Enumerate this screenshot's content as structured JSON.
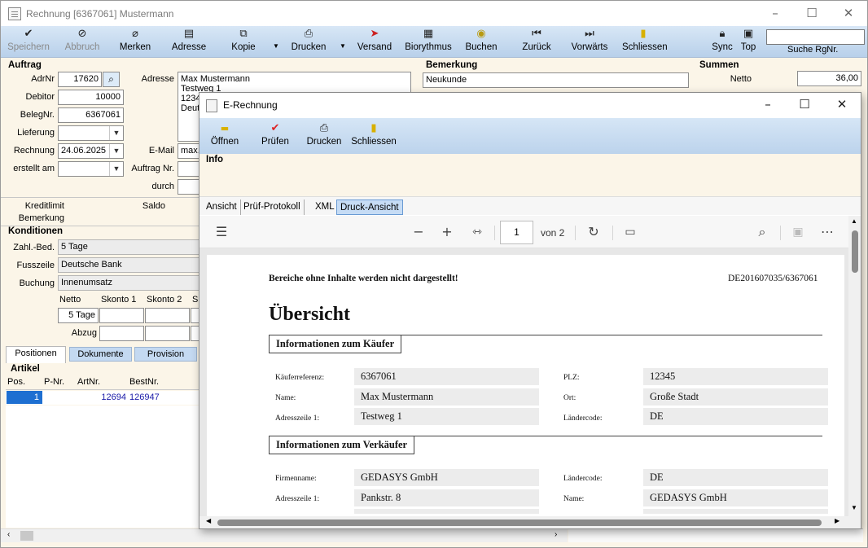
{
  "main_window": {
    "title": "Rechnung [6367061] Mustermann",
    "toolbar": {
      "speichern": "Speichern",
      "abbruch": "Abbruch",
      "merken": "Merken",
      "adresse": "Adresse",
      "kopie": "Kopie",
      "drucken": "Drucken",
      "versand": "Versand",
      "biorythmus": "Biorythmus",
      "buchen": "Buchen",
      "zurueck": "Zurück",
      "vorwaerts": "Vorwärts",
      "schliessen": "Schliessen",
      "sync": "Sync",
      "top": "Top",
      "search_value": "",
      "search_label": "Suche RgNr."
    },
    "auftrag": {
      "section": "Auftrag",
      "adrnr_label": "AdrNr",
      "adrnr": "17620",
      "debitor_label": "Debitor",
      "debitor": "10000",
      "belegnr_label": "BelegNr.",
      "belegnr": "6367061",
      "lieferung_label": "Lieferung",
      "lieferung": "",
      "rechnung_label": "Rechnung",
      "rechnung": "24.06.2025",
      "erstellt_label": "erstellt am",
      "erstellt": "",
      "adresse_label": "Adresse",
      "adresse_l1": "Max Mustermann",
      "adresse_l2": "Testweg 1",
      "adresse_l3": "1234",
      "adresse_l4": "Deut",
      "email_label": "E-Mail",
      "email": "max.",
      "auftragnr_label": "Auftrag Nr.",
      "durch_label": "durch"
    },
    "bemerkung": {
      "section": "Bemerkung",
      "value": "Neukunde"
    },
    "summen": {
      "section": "Summen",
      "netto_label": "Netto",
      "netto": "36,00"
    },
    "kredit": {
      "kreditlimit": "Kreditlimit",
      "saldo": "Saldo",
      "bemerkung": "Bemerkung"
    },
    "konditionen": {
      "section": "Konditionen",
      "zahl_label": "Zahl.-Bed.",
      "zahl": "5 Tage",
      "fuss_label": "Fusszeile",
      "fuss": "Deutsche Bank",
      "buchung_label": "Buchung",
      "buchung": "Innenumsatz",
      "netto_hdr": "Netto",
      "skonto1_hdr": "Skonto 1",
      "skonto2_hdr": "Skonto 2",
      "sk_hdr": "Sk",
      "netto_val": "5 Tage",
      "abzug_label": "Abzug"
    },
    "tabs": [
      "Positionen",
      "Dokumente",
      "Provision"
    ],
    "artikel": {
      "section": "Artikel",
      "columns": [
        "Pos.",
        "P-Nr.",
        "ArtNr.",
        "BestNr."
      ],
      "rows": [
        {
          "pos": "1",
          "pnr": "",
          "artnr": "12694",
          "bestnr": "126947"
        }
      ]
    }
  },
  "child_window": {
    "title": "E-Rechnung",
    "toolbar": {
      "oeffnen": "Öffnen",
      "pruefen": "Prüfen",
      "drucken": "Drucken",
      "schliessen": "Schliessen"
    },
    "info_label": "Info",
    "tabs": [
      "Ansicht",
      "Prüf-Protokoll",
      "XML",
      "Druck-Ansicht"
    ],
    "pdf": {
      "page": "1",
      "of_pages": "von 2"
    },
    "document": {
      "notice": "Bereiche ohne Inhalte werden nicht dargestellt!",
      "id": "DE201607035/6367061",
      "heading": "Übersicht",
      "buyer_title": "Informationen zum Käufer",
      "buyer": {
        "ref_label": "Käuferreferenz:",
        "ref": "6367061",
        "plz_label": "PLZ:",
        "plz": "12345",
        "name_label": "Name:",
        "name": "Max Mustermann",
        "ort_label": "Ort:",
        "ort": "Große Stadt",
        "addr_label": "Adresszeile 1:",
        "addr": "Testweg 1",
        "land_label": "Ländercode:",
        "land": "DE"
      },
      "seller_title": "Informationen zum Verkäufer",
      "seller": {
        "firm_label": "Firmenname:",
        "firm": "GEDASYS GmbH",
        "land_label": "Ländercode:",
        "land": "DE",
        "addr_label": "Adresszeile 1:",
        "addr": "Pankstr. 8",
        "name_label": "Name:",
        "name": "GEDASYS GmbH"
      }
    }
  }
}
